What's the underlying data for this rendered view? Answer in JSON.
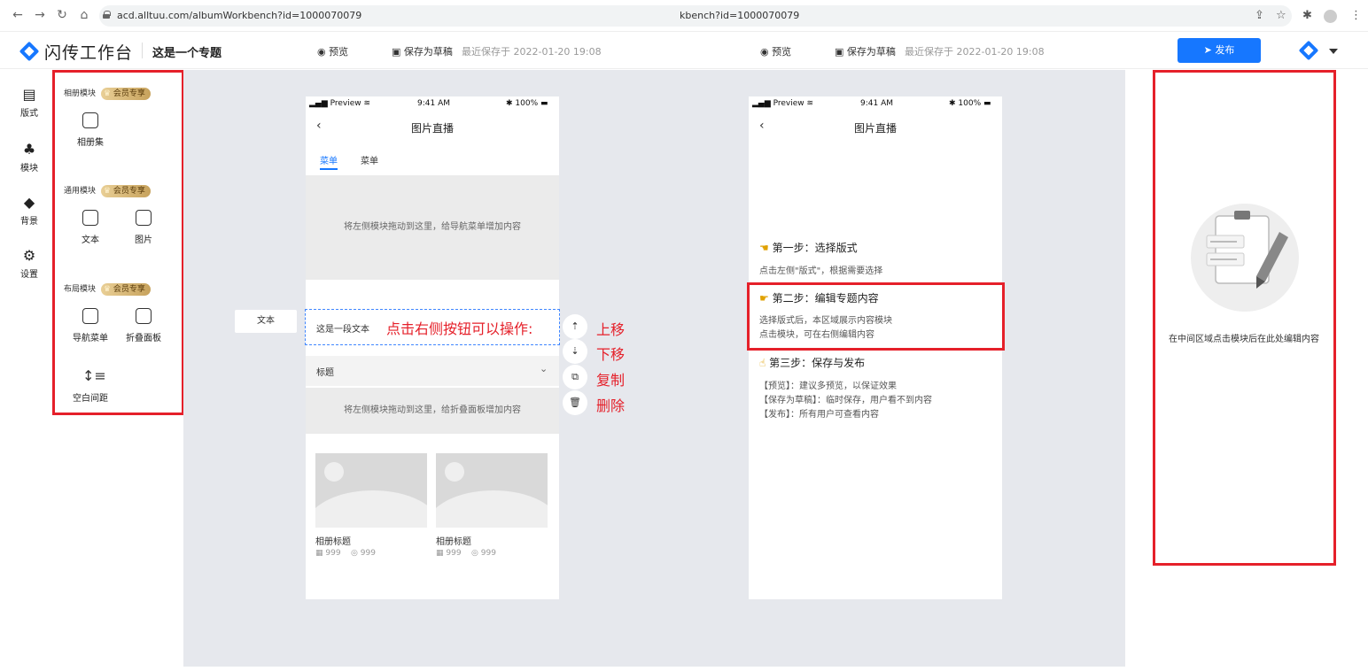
{
  "browser": {
    "url": "acd.alltuu.com/albumWorkbench?id=1000070079",
    "url_mid": "kbench?id=1000070079",
    "icons": [
      "back-icon",
      "forward-icon",
      "refresh-icon",
      "home-icon",
      "lock-icon",
      "share-icon",
      "star-icon",
      "extension-icon",
      "profile-icon",
      "menu-icon"
    ]
  },
  "header": {
    "app_title": "闪传工作台",
    "project_name": "这是一个专题",
    "preview": "预览",
    "save_draft": "保存为草稿",
    "last_saved": "最近保存于 2022-01-20 19:08",
    "publish": "发布",
    "accent": "#1677ff"
  },
  "rail": {
    "items": [
      {
        "label": "版式",
        "icon": "layout-icon"
      },
      {
        "label": "模块",
        "icon": "modules-icon"
      },
      {
        "label": "背景",
        "icon": "paint-bucket-icon"
      },
      {
        "label": "设置",
        "icon": "settings-icon"
      }
    ]
  },
  "modules": {
    "vip_badge": "会员专享",
    "sections": [
      {
        "label": "相册模块",
        "items": [
          {
            "label": "相册集",
            "icon": "album-collection-icon"
          }
        ]
      },
      {
        "label": "通用模块",
        "items": [
          {
            "label": "文本",
            "icon": "text-doc-icon"
          },
          {
            "label": "图片",
            "icon": "image-icon"
          }
        ]
      },
      {
        "label": "布局模块",
        "items": [
          {
            "label": "导航菜单",
            "icon": "nav-menu-icon"
          },
          {
            "label": "折叠面板",
            "icon": "collapse-panel-icon"
          },
          {
            "label": "空白间距",
            "icon": "spacing-icon"
          }
        ]
      }
    ]
  },
  "phone": {
    "carrier": "Preview",
    "time": "9:41 AM",
    "battery": "100%",
    "title": "图片直播"
  },
  "editor": {
    "tabs": [
      "菜单",
      "菜单"
    ],
    "nav_drop_hint": "将左侧模块拖动到这里，给导航菜单增加内容",
    "drag_tag": "文本",
    "text_block": "这是一段文本",
    "annotation": "点击右侧按钮可以操作:",
    "actions": [
      {
        "label": "上移",
        "icon": "move-up-icon"
      },
      {
        "label": "下移",
        "icon": "move-down-icon"
      },
      {
        "label": "复制",
        "icon": "copy-icon"
      },
      {
        "label": "删除",
        "icon": "delete-icon"
      }
    ],
    "collapse_title": "标题",
    "collapse_drop_hint": "将左侧模块拖动到这里，给折叠面板增加内容",
    "albums": [
      {
        "title": "相册标题",
        "photos": "999",
        "views": "999"
      },
      {
        "title": "相册标题",
        "photos": "999",
        "views": "999"
      }
    ]
  },
  "guide": {
    "step1_title": "第一步：选择版式",
    "step1_desc": "点击左侧\"版式\"，根据需要选择",
    "step2_title": "第二步：编辑专题内容",
    "step2_desc1": "选择版式后，本区域展示内容模块",
    "step2_desc2": "点击模块，可在右侧编辑内容",
    "step3_title": "第三步：保存与发布",
    "step3_desc1": "【预览】：建议多预览，以保证效果",
    "step3_desc2": "【保存为草稿】：临时保存，用户看不到内容",
    "step3_desc3": "【发布】：所有用户可查看内容"
  },
  "right_panel": {
    "empty_text": "在中间区域点击模块后在此处编辑内容"
  },
  "colors": {
    "highlight_red": "#e5202a",
    "canvas_bg": "#e6e8ed"
  }
}
